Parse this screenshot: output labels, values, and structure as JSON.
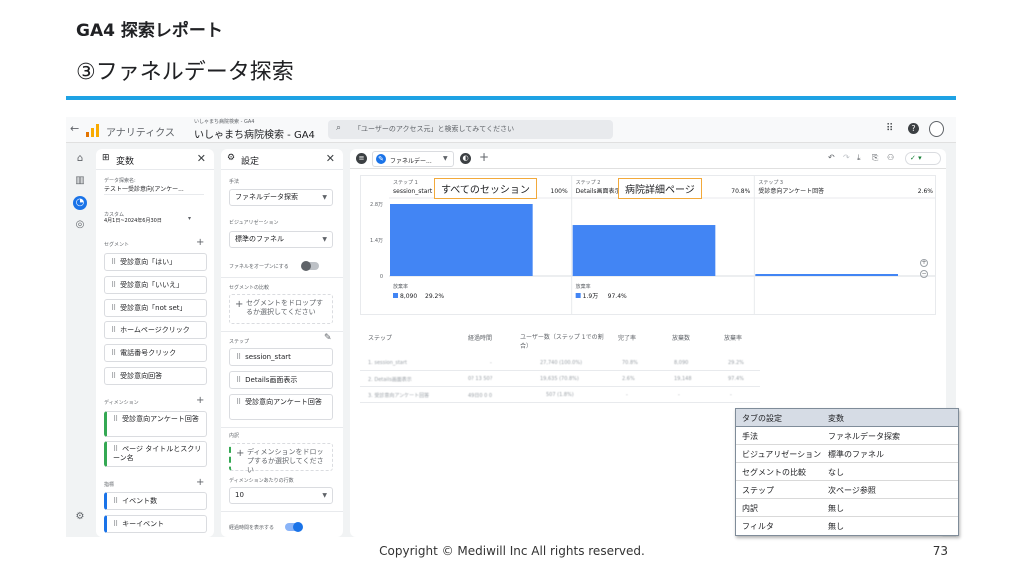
{
  "slide": {
    "title": "GA4 探索レポート",
    "subtitle": "③ファネルデータ探索",
    "footer": "Copyright © Mediwill Inc All rights reserved.",
    "page_number": "73"
  },
  "topbar": {
    "back_icon": "arrow-left-icon",
    "product_name": "アナリティクス",
    "account_path": "いしゃまち病院検索 - GA4",
    "property_name": "いしゃまち病院検索 - GA4",
    "search_placeholder": "「ユーザーのアクセス元」と検索してみてください"
  },
  "variables_panel": {
    "title": "変数",
    "data_name_label": "データ探索名:",
    "data_name_value": "テスト一受診意向(アンケー...",
    "date_label": "カスタム",
    "date_value": "4月1日~2024年6月30日",
    "segments_label": "セグメント",
    "segments": [
      "受診意向「はい」",
      "受診意向「いいえ」",
      "受診意向「not set」",
      "ホームページクリック",
      "電話番号クリック",
      "受診意向回答"
    ],
    "dimensions_label": "ディメンション",
    "dimensions": [
      "受診意向アンケート回答",
      "ページ タイトルとスクリーン名"
    ],
    "metrics_label": "指標",
    "metrics": [
      "イベント数",
      "キーイベント"
    ]
  },
  "settings_panel": {
    "title": "設定",
    "technique_label": "手法",
    "technique_value": "ファネルデータ探索",
    "visualization_label": "ビジュアリゼーション",
    "visualization_value": "標準のファネル",
    "open_funnel_label": "ファネルをオープンにする",
    "segment_compare_label": "セグメントの比較",
    "segment_drop_text": "セグメントをドロップするか選択してください",
    "steps_label": "ステップ",
    "steps": [
      "session_start",
      "Details画面表示",
      "受診意向アンケート回答"
    ],
    "breakdown_label": "内訳",
    "dimension_drop_text": "ディメンションをドロップするか選択してください",
    "rows_per_dim_label": "ディメンションあたりの行数",
    "rows_per_dim_value": "10",
    "show_elapsed_label": "経過時間を表示する"
  },
  "canvas": {
    "tab_label": "ファネルデー..."
  },
  "chart_data": {
    "type": "bar",
    "title": "",
    "categories": [
      "session_start",
      "Details画面表示",
      "受診意向アンケート回答"
    ],
    "step_labels": [
      "ステップ 1",
      "ステップ 2",
      "ステップ 3"
    ],
    "values": [
      100,
      70.8,
      2.6
    ],
    "percent_labels": [
      "100%",
      "70.8%",
      "2.6%"
    ],
    "ylim": [
      0,
      2.8
    ],
    "ytick_labels": [
      "2.8万",
      "1.4万",
      "0"
    ],
    "abandon_label": "放棄率",
    "abandon_values": [
      "8,090",
      "1.9万"
    ],
    "abandon_rates": [
      "29.2%",
      "97.4%"
    ],
    "grid": false
  },
  "callouts": [
    "すべてのセッション",
    "病院詳細ページ"
  ],
  "table": {
    "headers": [
      "ステップ",
      "経過時間",
      "ユーザー数（ステップ 1での割合）",
      "完了率",
      "放棄数",
      "放棄率"
    ],
    "rows": [
      [
        "1. session_start",
        "-",
        "27,740 (100.0%)",
        "70.8%",
        "8,090",
        "29.2%"
      ],
      [
        "2. Details画面表示",
        "0? 13 50?",
        "19,635 (70.8%)",
        "2.6%",
        "19,148",
        "97.4%"
      ],
      [
        "3. 受診意向アンケート回答",
        "49日0 0 0",
        "507 (1.8%)",
        "-",
        "-",
        "-"
      ]
    ]
  },
  "settings_table": {
    "headers": [
      "タブの設定",
      "変数"
    ],
    "rows": [
      [
        "手法",
        "ファネルデータ探索"
      ],
      [
        "ビジュアリゼーション",
        "標準のファネル"
      ],
      [
        "セグメントの比較",
        "なし"
      ],
      [
        "ステップ",
        "次ページ参照"
      ],
      [
        "内訳",
        "無し"
      ],
      [
        "フィルタ",
        "無し"
      ]
    ]
  },
  "colors": {
    "accent_blue": "#1ea2e4",
    "bar_blue": "#4285f4",
    "callout_border": "#f2a93b",
    "table_header_bg": "#d6dce5"
  }
}
